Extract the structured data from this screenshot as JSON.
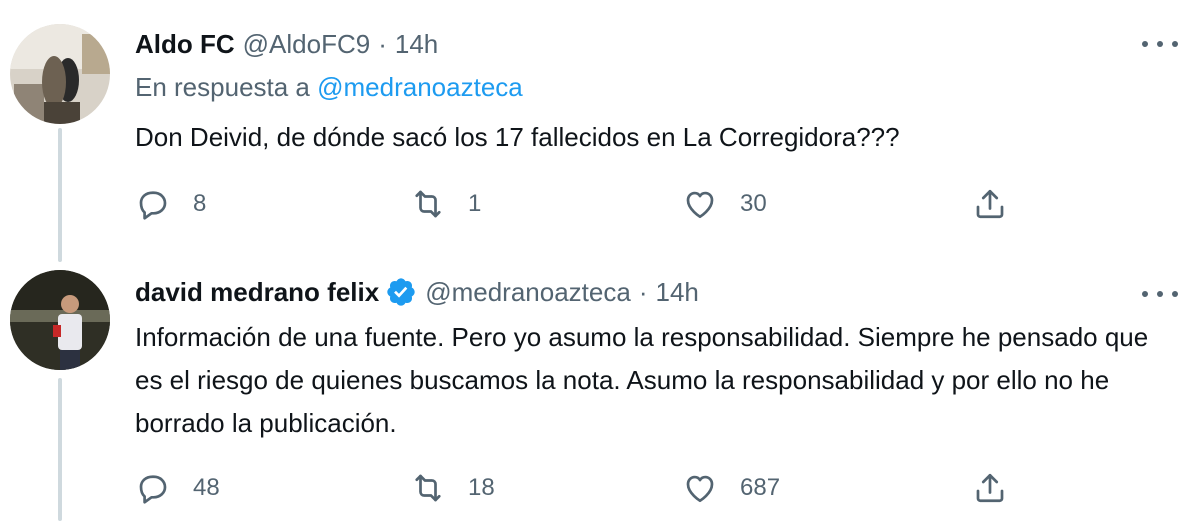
{
  "tweets": [
    {
      "display_name": "Aldo FC",
      "handle": "@AldoFC9",
      "separator": "·",
      "time": "14h",
      "reply_prefix": "En respuesta a",
      "reply_mention": "@medranoazteca",
      "text": "Don Deivid, de dónde sacó los 17 fallecidos en La Corregidora???",
      "replies": "8",
      "retweets": "1",
      "likes": "30",
      "verified": false
    },
    {
      "display_name": "david medrano felix",
      "handle": "@medranoazteca",
      "separator": "·",
      "time": "14h",
      "text": "Información de una fuente. Pero yo asumo la responsabilidad. Siempre he pensado que es el riesgo de quienes buscamos la nota. Asumo la responsabilidad y por ello no he borrado la publicación.",
      "replies": "48",
      "retweets": "18",
      "likes": "687",
      "verified": true
    }
  ],
  "colors": {
    "text": "#0f1419",
    "secondary": "#536471",
    "accent": "#1d9bf0",
    "thread_line": "#cfd9de"
  },
  "icons": [
    "reply-icon",
    "retweet-icon",
    "like-icon",
    "share-icon",
    "more-icon",
    "verified-badge-icon"
  ]
}
